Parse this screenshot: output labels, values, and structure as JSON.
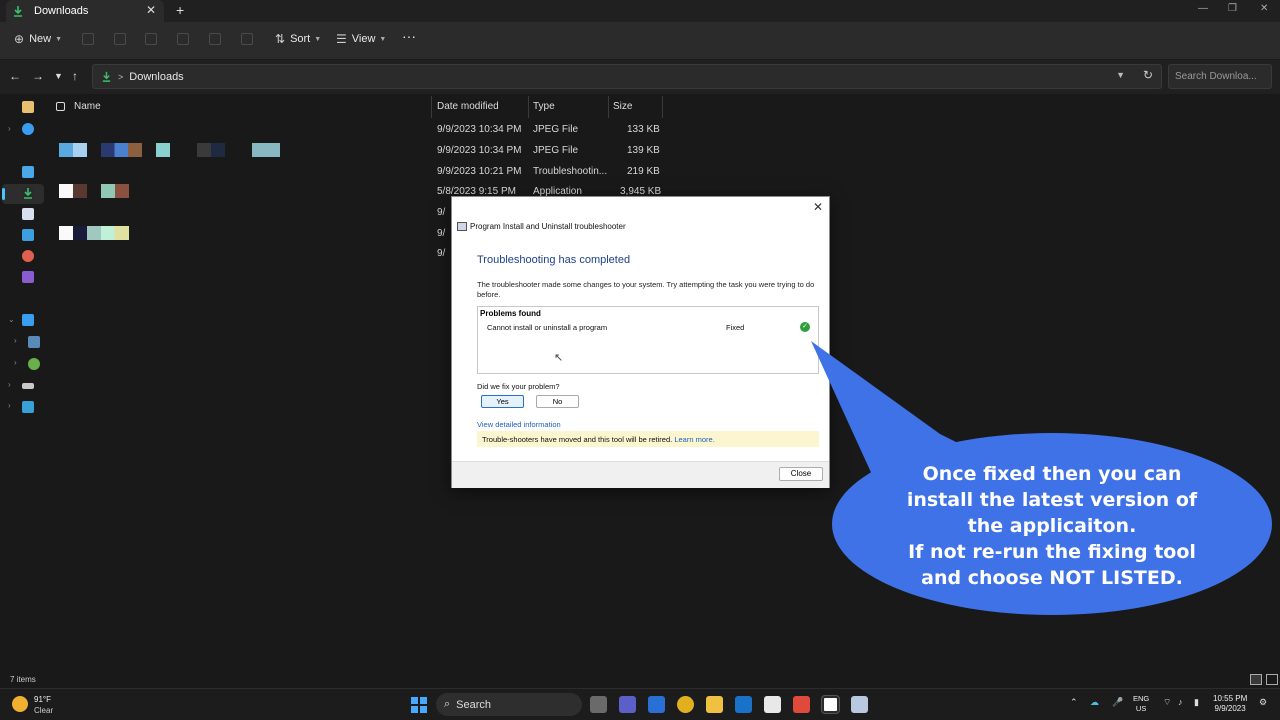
{
  "window": {
    "tab_title": "Downloads",
    "tab_close": "✕",
    "new_tab": "+",
    "minimize": "—",
    "maximize": "❐",
    "close": "✕"
  },
  "toolbar": {
    "new_label": "New",
    "sort_label": "Sort",
    "view_label": "View",
    "more_label": "···"
  },
  "address": {
    "path": "Downloads",
    "search_placeholder": "Search Downloa..."
  },
  "file_list": {
    "columns": [
      "Name",
      "Date modified",
      "Type",
      "Size"
    ],
    "rows": [
      {
        "date": "9/9/2023 10:34 PM",
        "type": "JPEG File",
        "size": "133 KB"
      },
      {
        "date": "9/9/2023 10:34 PM",
        "type": "JPEG File",
        "size": "139 KB"
      },
      {
        "date": "9/9/2023 10:21 PM",
        "type": "Troubleshootin...",
        "size": "219 KB"
      },
      {
        "date": "5/8/2023 9:15 PM",
        "type": "Application",
        "size": "3,945 KB"
      },
      {
        "date": "9/",
        "type": "",
        "size": ""
      },
      {
        "date": "9/",
        "type": "",
        "size": ""
      },
      {
        "date": "9/",
        "type": "",
        "size": ""
      }
    ]
  },
  "dialog": {
    "title": "Program Install and Uninstall troubleshooter",
    "close": "✕",
    "heading": "Troubleshooting has completed",
    "description": "The troubleshooter made some changes to your system. Try attempting the task you were trying to do before.",
    "problems_title": "Problems found",
    "problem_name": "Cannot install or uninstall a program",
    "problem_status": "Fixed",
    "question": "Did we fix your problem?",
    "yes_label": "Yes",
    "no_label": "No",
    "details_link": "View detailed information",
    "notice_text": "Trouble-shooters have moved and this tool will be retired.",
    "notice_link": "Learn more.",
    "close_label": "Close"
  },
  "callout": {
    "lines": [
      "Once fixed then you can",
      "install the latest version of",
      "the applicaiton.",
      "If not re-run the fixing tool",
      "and choose NOT LISTED."
    ],
    "color": "#3f72e6"
  },
  "status": {
    "item_count": "7 items"
  },
  "taskbar": {
    "temperature": "91°F",
    "condition": "Clear",
    "search_label": "Search",
    "language": "ENG",
    "region": "US",
    "time": "10:55 PM",
    "date": "9/9/2023"
  }
}
